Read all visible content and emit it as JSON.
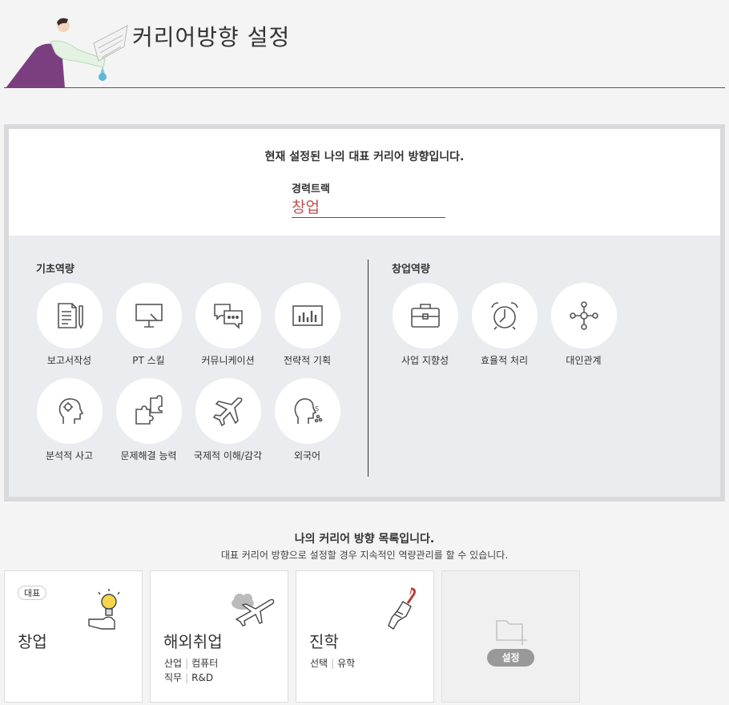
{
  "page": {
    "title": "커리어방향 설정"
  },
  "current": {
    "intro": "현재 설정된 나의 대표 커리어 방향입니다.",
    "track_label": "경력트랙",
    "track_value": "창업",
    "accent_color": "#c0514d"
  },
  "basic": {
    "title": "기초역량",
    "items": [
      {
        "label": "보고서작성",
        "icon": "document-pencil-icon"
      },
      {
        "label": "PT 스킬",
        "icon": "presentation-board-icon"
      },
      {
        "label": "커뮤니케이션",
        "icon": "chat-bubbles-icon"
      },
      {
        "label": "전략적 기획",
        "icon": "bar-chart-icon"
      },
      {
        "label": "분석적 사고",
        "icon": "head-gear-icon"
      },
      {
        "label": "문제해결 능력",
        "icon": "puzzle-icon"
      },
      {
        "label": "국제적 이해/감각",
        "icon": "airplane-icon"
      },
      {
        "label": "외국어",
        "icon": "speaking-head-icon"
      }
    ]
  },
  "startup": {
    "title": "창업역량",
    "items": [
      {
        "label": "사업 지향성",
        "icon": "briefcase-icon"
      },
      {
        "label": "효율적 처리",
        "icon": "alarm-clock-icon"
      },
      {
        "label": "대인관계",
        "icon": "network-icon"
      }
    ]
  },
  "list": {
    "heading": "나의 커리어 방향 목록입니다.",
    "subheading": "대표 커리어 방향으로 설정할 경우 지속적인 역량관리를 할 수 있습니다.",
    "cards": [
      {
        "badge": "대표",
        "name": "창업",
        "icon": "lightbulb-hand-icon"
      },
      {
        "name": "해외취업",
        "line1": [
          "산업",
          "컴퓨터"
        ],
        "line2": [
          "직무",
          "R&D"
        ],
        "icon": "airplane-cloud-icon"
      },
      {
        "name": "진학",
        "line1": [
          "선택",
          "유학"
        ],
        "icon": "paintbrush-hand-icon"
      }
    ],
    "empty_card": {
      "button": "설정",
      "icon": "folder-add-icon"
    }
  }
}
